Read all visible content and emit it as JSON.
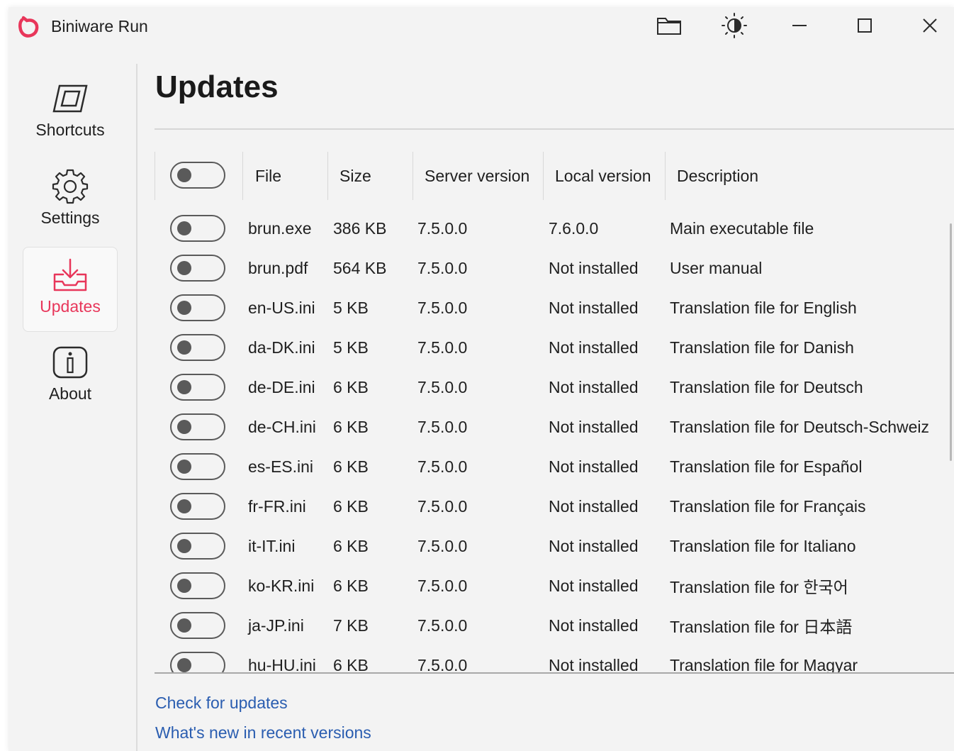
{
  "app": {
    "title": "Biniware Run",
    "logo_icon": "biniware-logo-icon",
    "accent_color": "#e8365a"
  },
  "titlebar": {
    "folder_icon": "folder-icon",
    "theme_icon": "brightness-contrast-icon",
    "minimize_icon": "minimize-icon",
    "maximize_icon": "maximize-icon",
    "close_icon": "close-icon"
  },
  "sidebar": {
    "items": [
      {
        "label": "Shortcuts",
        "icon": "shortcuts-icon",
        "active": false
      },
      {
        "label": "Settings",
        "icon": "gear-icon",
        "active": false
      },
      {
        "label": "Updates",
        "icon": "download-tray-icon",
        "active": true
      },
      {
        "label": "About",
        "icon": "info-icon",
        "active": false
      }
    ]
  },
  "main": {
    "title": "Updates",
    "table": {
      "columns": [
        "File",
        "Size",
        "Server version",
        "Local version",
        "Description"
      ],
      "rows": [
        {
          "file": "brun.exe",
          "size": "386 KB",
          "server": "7.5.0.0",
          "local": "7.6.0.0",
          "description": "Main executable file",
          "enabled": false
        },
        {
          "file": "brun.pdf",
          "size": "564 KB",
          "server": "7.5.0.0",
          "local": "Not installed",
          "description": "User manual",
          "enabled": false
        },
        {
          "file": "en-US.ini",
          "size": "5 KB",
          "server": "7.5.0.0",
          "local": "Not installed",
          "description": "Translation file for English",
          "enabled": false
        },
        {
          "file": "da-DK.ini",
          "size": "5 KB",
          "server": "7.5.0.0",
          "local": "Not installed",
          "description": "Translation file for Danish",
          "enabled": false
        },
        {
          "file": "de-DE.ini",
          "size": "6 KB",
          "server": "7.5.0.0",
          "local": "Not installed",
          "description": "Translation file for Deutsch",
          "enabled": false
        },
        {
          "file": "de-CH.ini",
          "size": "6 KB",
          "server": "7.5.0.0",
          "local": "Not installed",
          "description": "Translation file for Deutsch-Schweiz",
          "enabled": false
        },
        {
          "file": "es-ES.ini",
          "size": "6 KB",
          "server": "7.5.0.0",
          "local": "Not installed",
          "description": "Translation file for Español",
          "enabled": false
        },
        {
          "file": "fr-FR.ini",
          "size": "6 KB",
          "server": "7.5.0.0",
          "local": "Not installed",
          "description": "Translation file for Français",
          "enabled": false
        },
        {
          "file": "it-IT.ini",
          "size": "6 KB",
          "server": "7.5.0.0",
          "local": "Not installed",
          "description": "Translation file for Italiano",
          "enabled": false
        },
        {
          "file": "ko-KR.ini",
          "size": "6 KB",
          "server": "7.5.0.0",
          "local": "Not installed",
          "description": "Translation file for 한국어",
          "enabled": false
        },
        {
          "file": "ja-JP.ini",
          "size": "7 KB",
          "server": "7.5.0.0",
          "local": "Not installed",
          "description": "Translation file for 日本語",
          "enabled": false
        },
        {
          "file": "hu-HU.ini",
          "size": "6 KB",
          "server": "7.5.0.0",
          "local": "Not installed",
          "description": "Translation file for Magyar",
          "enabled": false
        }
      ]
    },
    "links": {
      "check_updates": "Check for updates",
      "whats_new": "What's new in recent versions"
    }
  }
}
